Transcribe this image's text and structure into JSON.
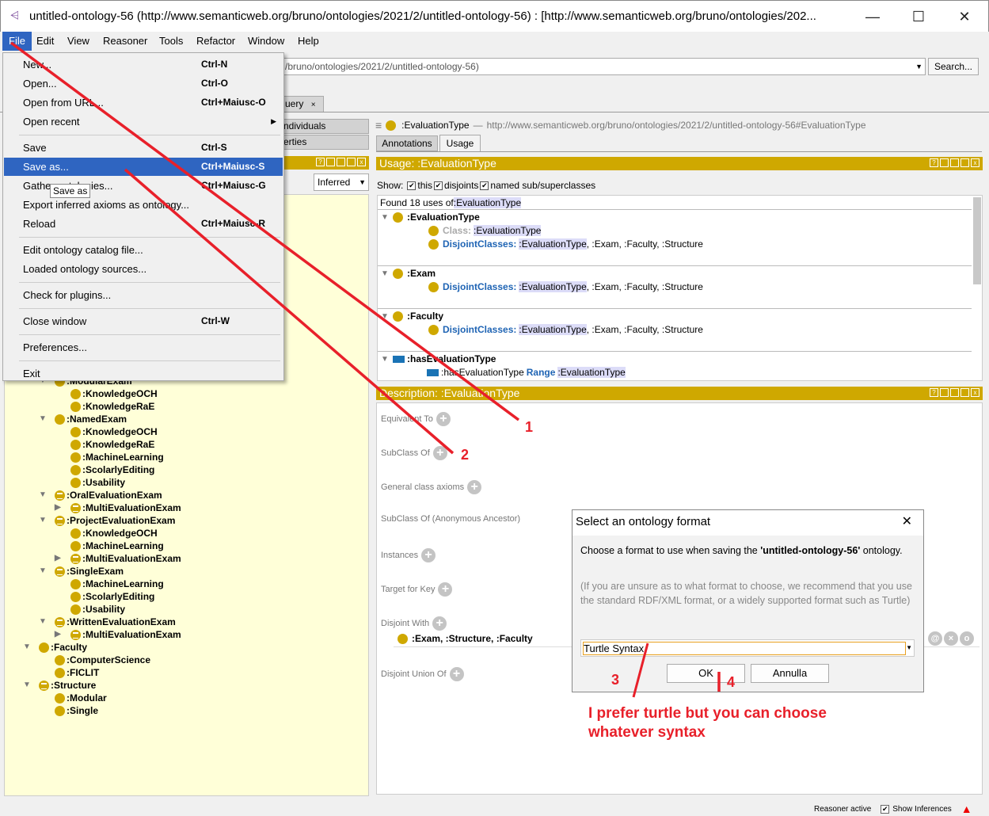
{
  "window": {
    "title": "untitled-ontology-56 (http://www.semanticweb.org/bruno/ontologies/2021/2/untitled-ontology-56)  : [http://www.semanticweb.org/bruno/ontologies/202...",
    "minimize": "—",
    "maximize": "☐",
    "close": "✕"
  },
  "menubar": [
    "File",
    "Edit",
    "View",
    "Reasoner",
    "Tools",
    "Refactor",
    "Window",
    "Help"
  ],
  "address": {
    "value": "/bruno/ontologies/2021/2/untitled-ontology-56)",
    "search": "Search..."
  },
  "tab_fragment": "uery",
  "tab_close": "×",
  "left": {
    "tab1": "ndividuals",
    "tab2": "erties",
    "inferred": "Inferred",
    "tree": [
      {
        "label": ":ModularExam",
        "d": 2,
        "icon": "class",
        "tog": "down"
      },
      {
        "label": ":KnowledgeOCH",
        "d": 3,
        "icon": "class"
      },
      {
        "label": ":KnowledgeRaE",
        "d": 3,
        "icon": "class"
      },
      {
        "label": ":NamedExam",
        "d": 2,
        "icon": "class",
        "tog": "down"
      },
      {
        "label": ":KnowledgeOCH",
        "d": 3,
        "icon": "class"
      },
      {
        "label": ":KnowledgeRaE",
        "d": 3,
        "icon": "class"
      },
      {
        "label": ":MachineLearning",
        "d": 3,
        "icon": "class"
      },
      {
        "label": ":ScolarlyEditing",
        "d": 3,
        "icon": "class"
      },
      {
        "label": ":Usability",
        "d": 3,
        "icon": "class"
      },
      {
        "label": ":OralEvaluationExam",
        "d": 2,
        "icon": "defined",
        "tog": "down"
      },
      {
        "label": ":MultiEvaluationExam",
        "d": 3,
        "icon": "defined",
        "tog": "right"
      },
      {
        "label": ":ProjectEvaluationExam",
        "d": 2,
        "icon": "defined",
        "tog": "down"
      },
      {
        "label": ":KnowledgeOCH",
        "d": 3,
        "icon": "class"
      },
      {
        "label": ":MachineLearning",
        "d": 3,
        "icon": "class"
      },
      {
        "label": ":MultiEvaluationExam",
        "d": 3,
        "icon": "defined",
        "tog": "right"
      },
      {
        "label": ":SingleExam",
        "d": 2,
        "icon": "defined",
        "tog": "down"
      },
      {
        "label": ":MachineLearning",
        "d": 3,
        "icon": "class"
      },
      {
        "label": ":ScolarlyEditing",
        "d": 3,
        "icon": "class"
      },
      {
        "label": ":Usability",
        "d": 3,
        "icon": "class"
      },
      {
        "label": ":WrittenEvaluationExam",
        "d": 2,
        "icon": "defined",
        "tog": "down"
      },
      {
        "label": ":MultiEvaluationExam",
        "d": 3,
        "icon": "defined",
        "tog": "right"
      },
      {
        "label": ":Faculty",
        "d": 1,
        "icon": "class",
        "tog": "down"
      },
      {
        "label": ":ComputerScience",
        "d": 2,
        "icon": "class"
      },
      {
        "label": ":FICLIT",
        "d": 2,
        "icon": "class"
      },
      {
        "label": ":Structure",
        "d": 1,
        "icon": "defined",
        "tog": "down"
      },
      {
        "label": ":Modular",
        "d": 2,
        "icon": "class"
      },
      {
        "label": ":Single",
        "d": 2,
        "icon": "class"
      }
    ]
  },
  "file_menu": [
    {
      "label": "New...",
      "key": "Ctrl-N"
    },
    {
      "label": "Open...",
      "key": "Ctrl-O"
    },
    {
      "label": "Open from URL...",
      "key": "Ctrl+Maiusc-O"
    },
    {
      "label": "Open recent",
      "key": "",
      "sub": true
    },
    {
      "sep": true
    },
    {
      "label": "Save",
      "key": "Ctrl-S"
    },
    {
      "label": "Save as...",
      "key": "Ctrl+Maiusc-S",
      "selected": true
    },
    {
      "label": "Gather ontologies...",
      "key": "Ctrl+Maiusc-G"
    },
    {
      "label": "Export inferred axioms as ontology...",
      "key": ""
    },
    {
      "label": "Reload",
      "key": "Ctrl+Maiusc-R"
    },
    {
      "sep": true
    },
    {
      "label": "Edit ontology catalog file...",
      "key": ""
    },
    {
      "label": "Loaded ontology sources...",
      "key": ""
    },
    {
      "sep": true
    },
    {
      "label": "Check for plugins...",
      "key": ""
    },
    {
      "sep": true
    },
    {
      "label": "Close window",
      "key": "Ctrl-W"
    },
    {
      "sep": true
    },
    {
      "label": "Preferences...",
      "key": ""
    },
    {
      "sep": true
    },
    {
      "label": "Exit",
      "key": ""
    }
  ],
  "tooltip": "Save as",
  "entity": {
    "name": ":EvaluationType",
    "dash": "—",
    "iri": "http://www.semanticweb.org/bruno/ontologies/2021/2/untitled-ontology-56#EvaluationType"
  },
  "right_tabs": [
    "Annotations",
    "Usage"
  ],
  "usage": {
    "header": "Usage: :EvaluationType",
    "show": "Show:",
    "this": "this",
    "disjoints": "disjoints",
    "named": "named sub/superclasses",
    "found": "Found 18 uses of ",
    "found_entity": ":EvaluationType",
    "groups": [
      {
        "title": ":EvaluationType",
        "rows": [
          {
            "kw": "Class:",
            "kwgray": true,
            "hl": ":EvaluationType",
            "rest": ""
          },
          {
            "kw": "DisjointClasses:",
            "hl": ":EvaluationType",
            "rest": ", :Exam, :Faculty, :Structure"
          }
        ]
      },
      {
        "title": ":Exam",
        "rows": [
          {
            "kw": "DisjointClasses:",
            "hl": ":EvaluationType",
            "rest": ", :Exam, :Faculty, :Structure"
          }
        ]
      },
      {
        "title": ":Faculty",
        "rows": [
          {
            "kw": "DisjointClasses:",
            "hl": ":EvaluationType",
            "rest": ", :Exam, :Faculty, :Structure"
          }
        ]
      },
      {
        "title": ":hasEvaluationType",
        "prop": true,
        "rows": [
          {
            "pre": ":hasEvaluationType",
            "kw": "Range",
            "hl": ":EvaluationType",
            "rest": ""
          }
        ]
      }
    ]
  },
  "description": {
    "header": "Description: :EvaluationType",
    "sections": [
      "Equivalent To",
      "SubClass Of",
      "General class axioms",
      "SubClass Of (Anonymous Ancestor)",
      "Instances",
      "Target for Key",
      "Disjoint With",
      "Disjoint Union Of"
    ],
    "disjoint_value": ":Exam, :Structure, :Faculty",
    "row_icons": [
      "@",
      "×",
      "o"
    ]
  },
  "dialog": {
    "title": "Select an ontology format",
    "close": "✕",
    "msg_pre": "Choose a format to use when saving the ",
    "msg_bold": "'untitled-ontology-56'",
    "msg_post": " ontology.",
    "hint": "(If you are unsure as to what format to choose, we recommend that you use the standard RDF/XML format, or a widely supported format such as Turtle)",
    "format": "Turtle Syntax",
    "ok": "OK",
    "cancel": "Annulla"
  },
  "annotations": {
    "n1": "1",
    "n2": "2",
    "n3": "3",
    "n4": "4",
    "note": "I prefer turtle but you can choose whatever syntax",
    "color": "#e8202a"
  },
  "status": {
    "reasoner": "Reasoner active",
    "show_inf": "Show Inferences"
  },
  "colors": {
    "gold": "#cfa800",
    "menu_sel": "#2f65c1",
    "tree_bg": "#ffffd8"
  }
}
